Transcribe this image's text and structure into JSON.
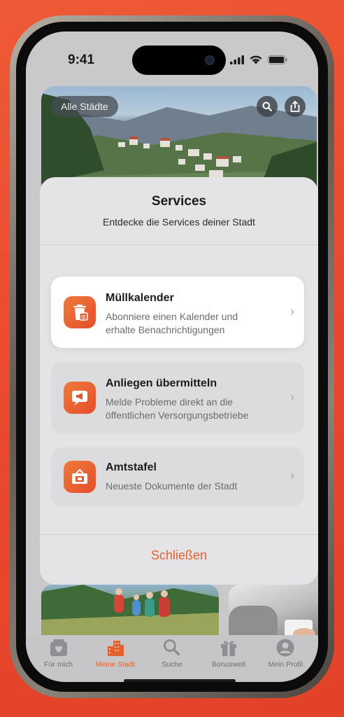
{
  "status": {
    "time": "9:41"
  },
  "header": {
    "city_button": "Alle Städte"
  },
  "sheet": {
    "title": "Services",
    "subtitle": "Entdecke die Services deiner Stadt",
    "items": [
      {
        "title": "Müllkalender",
        "desc_line1": "Abonniere einen Kalender und",
        "desc_line2": "erhalte Benachrichtigungen",
        "icon": "trash-calendar-icon"
      },
      {
        "title": "Anliegen übermitteln",
        "desc_line1": "Melde Probleme direkt an die",
        "desc_line2": "öffentlichen Versorgungsbetriebe",
        "icon": "megaphone-icon"
      },
      {
        "title": "Amtstafel",
        "desc_line1": "Neueste Dokumente der Stadt",
        "desc_line2": "",
        "icon": "notice-board-icon"
      }
    ],
    "close_label": "Schließen"
  },
  "tabs": [
    {
      "label": "Für mich",
      "icon": "inbox-icon"
    },
    {
      "label": "Meine Stadt",
      "icon": "city-icon"
    },
    {
      "label": "Suche",
      "icon": "search-icon"
    },
    {
      "label": "Bonuswelt",
      "icon": "gift-icon"
    },
    {
      "label": "Mein Profil",
      "icon": "profile-icon"
    }
  ],
  "colors": {
    "accent": "#e4612e",
    "background": "#e8482c"
  }
}
